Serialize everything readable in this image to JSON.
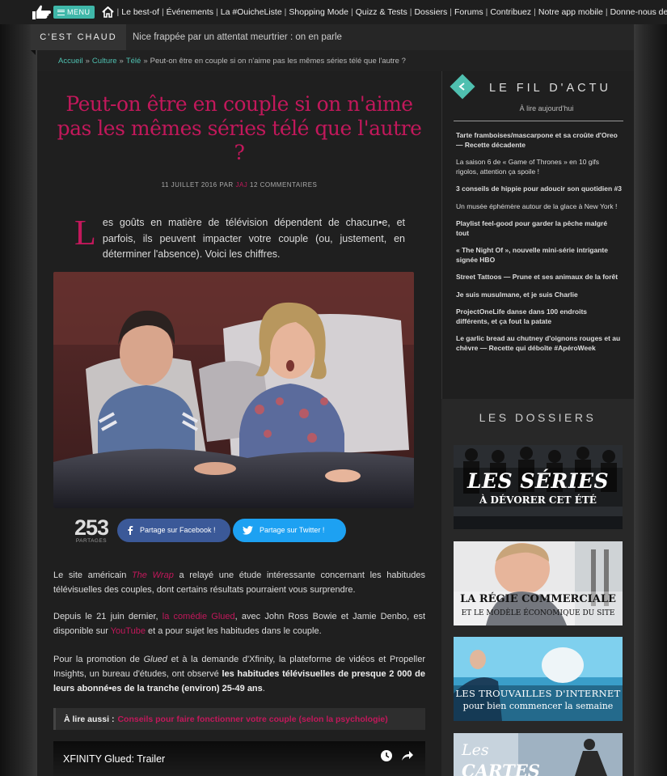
{
  "nav": {
    "menu_label": "MENU",
    "links": [
      "Le best-of",
      "Événements",
      "La #OuicheListe",
      "Shopping Mode",
      "Quizz & Tests",
      "Dossiers",
      "Forums",
      "Contribuez",
      "Notre app mobile",
      "Donne-nous des sous"
    ]
  },
  "hot": {
    "label": "C'EST CHAUD",
    "text": "Nice frappée par un attentat meurtrier : on en parle"
  },
  "breadcrumb": {
    "home": "Accueil",
    "cat1": "Culture",
    "cat2": "Télé",
    "current": "Peut-on être en couple si on n'aime pas les mêmes séries télé que l'autre ?"
  },
  "article": {
    "title": "Peut-on être en couple si on n'aime pas les mêmes séries télé que l'autre ?",
    "meta_date": "11 JUILLET 2016 PAR",
    "meta_author": "JAJ",
    "meta_comments": "12 COMMENTAIRES",
    "lead_cap": "L",
    "lead": "es goûts en matière de télévision dépendent de chacun•e, et parfois, ils peuvent impacter votre couple (ou, justement, en déterminer l'absence). Voici les chiffres.",
    "share_count": "253",
    "share_label": "PARTAGES",
    "share_fb": "Partage sur Facebook !",
    "share_tw": "Partage sur Twitter !",
    "p1_a": "Le site américain ",
    "p1_link": "The Wrap",
    "p1_b": " a relayé une étude intéressante concernant les habitudes télévisuelles des couples, dont certains résultats pourraient vous surprendre.",
    "p2_a": "Depuis le 21 juin dernier, ",
    "p2_link": "la comédie Glued",
    "p2_b": ", avec John Ross Bowie et Jamie Denbo, est disponible sur ",
    "p2_link2": "YouTube",
    "p2_c": " et a pour sujet les habitudes dans le couple.",
    "p3_a": "Pour la promotion de ",
    "p3_em": "Glued",
    "p3_b": " et à la demande d'Xfinity, la plateforme de vidéos et Propeller Insights, un bureau d'études, ont observé ",
    "p3_bold": "les habitudes télévisuelles de presque 2 000 de leurs abonné•es de la tranche (environ) 25-49 ans",
    "p3_c": ".",
    "also_label": "À lire aussi :",
    "also_link": "Conseils pour faire fonctionner votre couple (selon la psychologie)",
    "video_title": "XFINITY Glued: Trailer"
  },
  "fil": {
    "title": "LE FIL D'ACTU",
    "subtitle": "À lire aujourd'hui",
    "items": [
      {
        "text": "Tarte framboises/mascarpone et sa croûte d'Oreo — Recette décadente",
        "bold": true
      },
      {
        "text": "La saison 6 de « Game of Thrones » en 10 gifs rigolos, attention ça spoile !",
        "bold": false
      },
      {
        "text": "3 conseils de hippie pour adoucir son quotidien #3",
        "bold": true
      },
      {
        "text": "Un musée éphémère autour de la glace à New York !",
        "bold": false
      },
      {
        "text": "Playlist feel-good pour garder la pêche malgré tout",
        "bold": true
      },
      {
        "text": "« The Night Of », nouvelle mini-série intrigante signée HBO",
        "bold": true
      },
      {
        "text": "Street Tattoos — Prune et ses animaux de la forêt",
        "bold": true
      },
      {
        "text": "Je suis musulmane, et je suis Charlie",
        "bold": true
      },
      {
        "text": "ProjectOneLife danse dans 100 endroits différents, et ça fout la patate",
        "bold": true
      },
      {
        "text": "Le garlic bread au chutney d'oignons rouges et au chèvre — Recette qui déboîte #ApéroWeek",
        "bold": true
      }
    ]
  },
  "dossiers": {
    "title": "LES DOSSIERS",
    "card1_l1": "LES SÉRIES",
    "card1_l2": "À DÉVORER CET ÉTÉ",
    "card2_l1": "LA RÉGIE COMMERCIALE",
    "card2_l2": "ET LE MODÈLE ÉCONOMIQUE DU SITE",
    "card3_l1": "LES TROUVAILLES D'INTERNET",
    "card3_l2": "pour bien commencer la semaine",
    "card4_l1": "Les",
    "card4_l2": "CARTES"
  },
  "colors": {
    "accent_pink": "#c2185b",
    "accent_teal": "#4fc0b0",
    "facebook": "#3b5998",
    "twitter": "#1da1f2"
  }
}
